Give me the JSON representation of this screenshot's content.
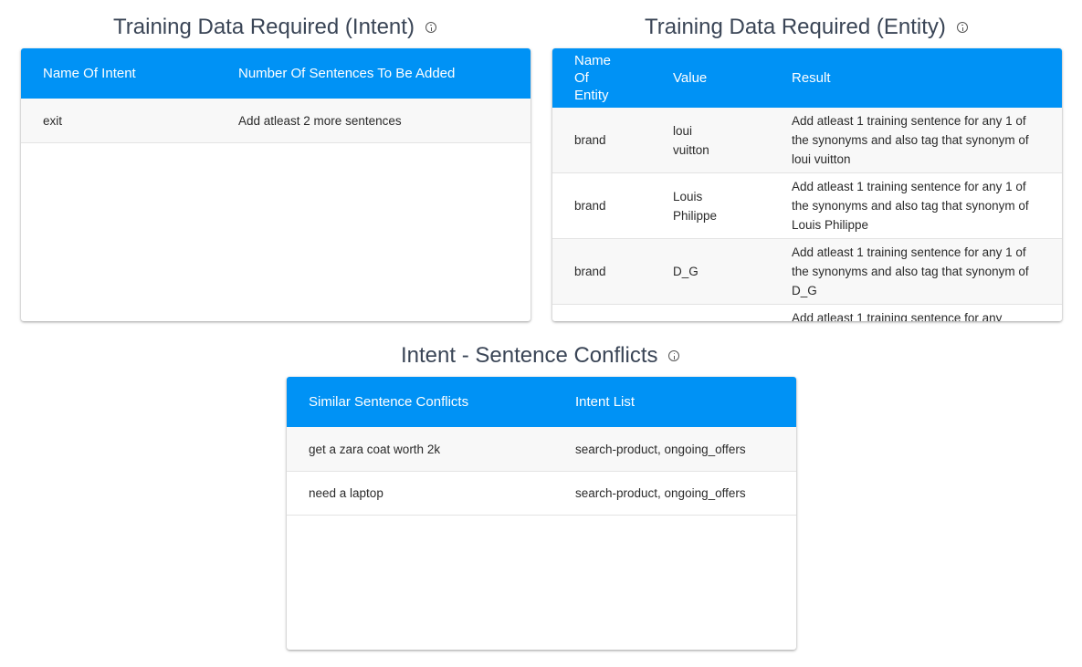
{
  "intent_panel": {
    "title": "Training Data Required (Intent)",
    "headers": [
      "Name Of Intent",
      "Number Of Sentences To Be Added"
    ],
    "rows": [
      {
        "name": "exit",
        "count": "Add atleast 2 more sentences"
      }
    ]
  },
  "entity_panel": {
    "title": "Training Data Required (Entity)",
    "headers": [
      "Name\nOf\nEntity",
      "Value",
      "Result"
    ],
    "rows": [
      {
        "name": "brand",
        "value": "loui\nvuitton",
        "result": "Add atleast 1 training sentence for any 1 of the synonyms and also tag that synonym of loui vuitton"
      },
      {
        "name": "brand",
        "value": "Louis\nPhilippe",
        "result": "Add atleast 1 training sentence for any 1 of the synonyms and also tag that synonym of Louis Philippe"
      },
      {
        "name": "brand",
        "value": "D_G",
        "result": "Add atleast 1 training sentence for any 1 of the synonyms and also tag that synonym of D_G"
      },
      {
        "name": "",
        "value": "",
        "result": "Add atleast 1 training sentence for any"
      }
    ]
  },
  "conflict_panel": {
    "title": "Intent - Sentence Conflicts",
    "headers": [
      "Similar Sentence Conflicts",
      "Intent List"
    ],
    "rows": [
      {
        "sentence": "get a zara coat worth 2k",
        "intents": "search-product, ongoing_offers"
      },
      {
        "sentence": "need a laptop",
        "intents": "search-product, ongoing_offers"
      }
    ]
  },
  "colors": {
    "header_blue": "#0092f5",
    "title_text": "#3a4556"
  },
  "icons": {
    "info": "info-icon"
  }
}
